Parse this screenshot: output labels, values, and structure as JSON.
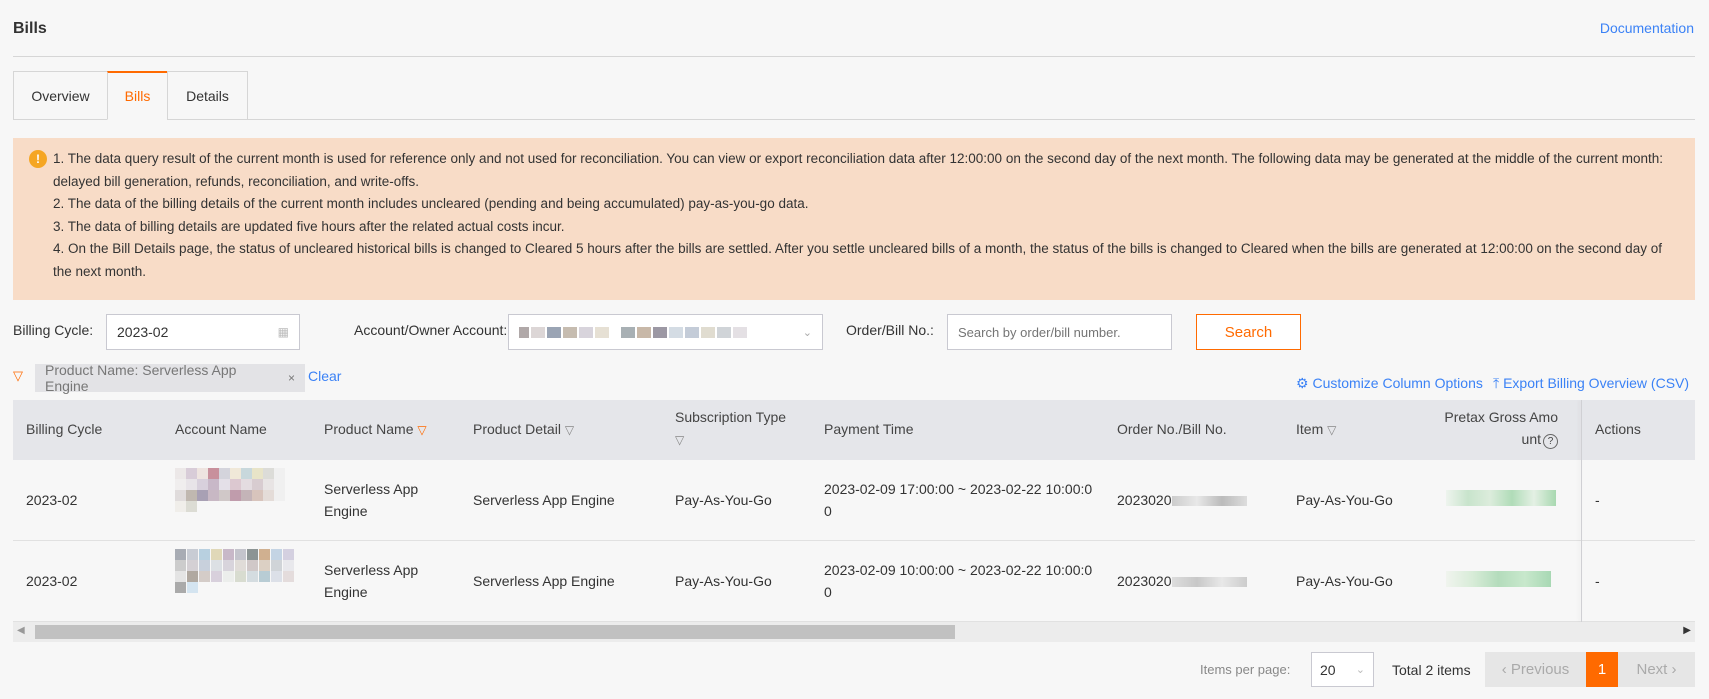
{
  "header": {
    "title": "Bills",
    "doc_link": "Documentation"
  },
  "tabs": [
    {
      "label": "Overview"
    },
    {
      "label": "Bills",
      "active": true
    },
    {
      "label": "Details"
    }
  ],
  "notice": {
    "icon": "info-icon",
    "lines": [
      "1. The data query result of the current month is used for reference only and not used for reconciliation. You can view or export reconciliation data after 12:00:00 on the second day of the next month. The following data may be generated at the middle of the current month: delayed bill generation, refunds, reconciliation, and write-offs.",
      "2. The data of the billing details of the current month includes uncleared (pending and being accumulated) pay-as-you-go data.",
      "3. The data of billing details are updated five hours after the related actual costs incur.",
      "4. On the Bill Details page, the status of uncleared historical bills is changed to Cleared 5 hours after the bills are settled. After you settle uncleared bills of a month, the status of the bills is changed to Cleared when the bills are generated at 12:00:00 on the second day of the next month."
    ]
  },
  "filters": {
    "billing_cycle_label": "Billing Cycle:",
    "billing_cycle_value": "2023-02",
    "account_label": "Account/Owner Account:",
    "order_label": "Order/Bill No.:",
    "order_placeholder": "Search by order/bill number.",
    "search_label": "Search"
  },
  "active_filter": {
    "chip": "Product Name: Serverless App Engine",
    "remove": "×",
    "clear": "Clear"
  },
  "toolbar": {
    "customize": "Customize Column Options",
    "export": "Export Billing Overview (CSV)"
  },
  "table": {
    "columns": [
      "Billing Cycle",
      "Account Name",
      "Product Name",
      "Product Detail",
      "Subscription Type",
      "Payment Time",
      "Order No./Bill No.",
      "Item",
      "Pretax Gross Amount",
      "Actions"
    ],
    "rows": [
      {
        "cycle": "2023-02",
        "product": "Serverless App Engine",
        "detail": "Serverless App Engine",
        "sub": "Pay-As-You-Go",
        "time": "2023-02-09 17:00:00  ~  2023-02-22 10:00:00",
        "order": "2023020",
        "item": "Pay-As-You-Go",
        "action": "-"
      },
      {
        "cycle": "2023-02",
        "product": "Serverless App Engine",
        "detail": "Serverless App Engine",
        "sub": "Pay-As-You-Go",
        "time": "2023-02-09 10:00:00  ~  2023-02-22 10:00:00",
        "order": "2023020",
        "item": "Pay-As-You-Go",
        "action": "-"
      }
    ]
  },
  "pagination": {
    "items_per_page_label": "Items per page:",
    "page_size": "20",
    "total": "Total 2 items",
    "prev": "‹  Previous",
    "current": "1",
    "next": "Next  ›"
  },
  "colors": {
    "accent": "#ff6a00",
    "link": "#3b82f6",
    "notice_bg": "#f8dcc7"
  }
}
